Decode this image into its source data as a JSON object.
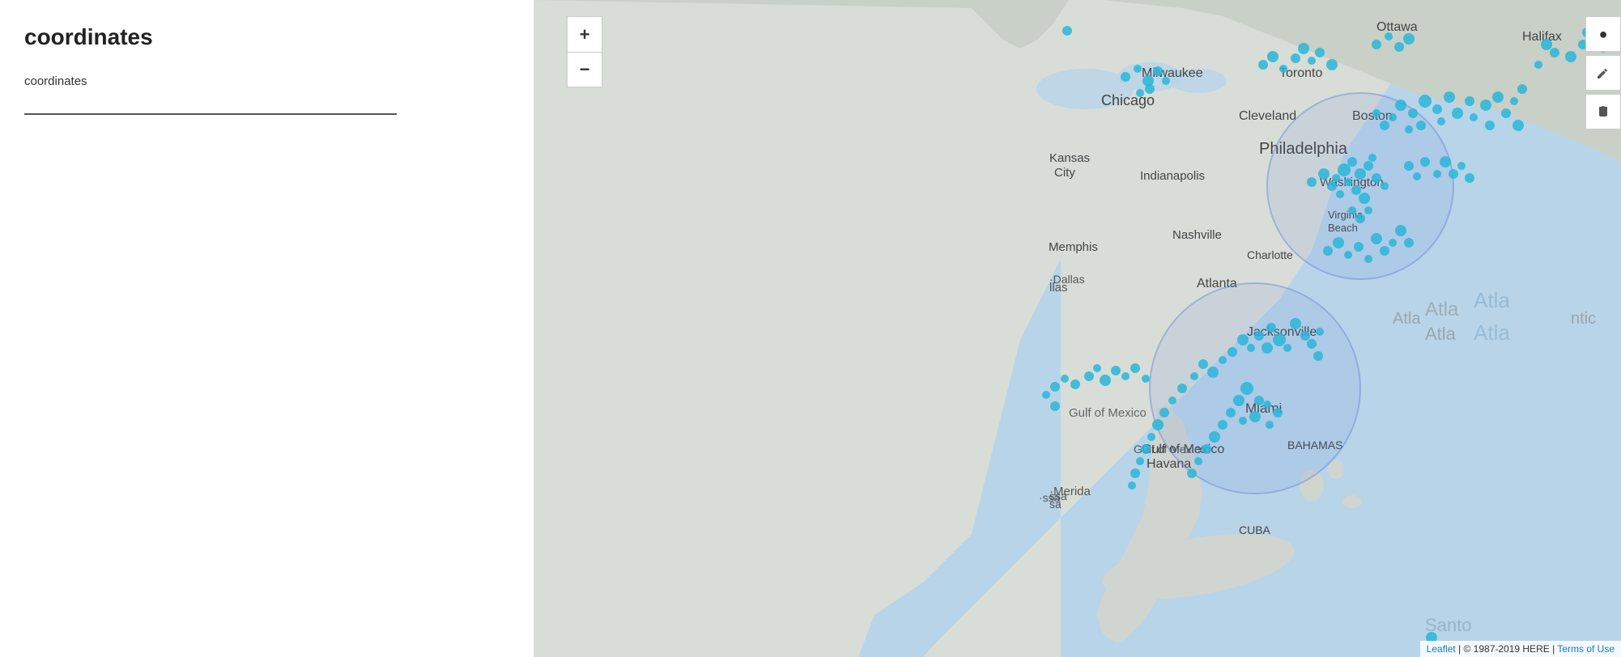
{
  "left_panel": {
    "title": "coordinates",
    "field_label": "coordinates",
    "field_placeholder": ""
  },
  "map": {
    "zoom_in_label": "+",
    "zoom_out_label": "−",
    "attribution_text": "| © 1987-2019 HERE |",
    "leaflet_link_text": "Leaflet",
    "terms_link_text": "Terms of Use",
    "city_labels": [
      "Ottawa",
      "Halifax",
      "Toronto",
      "Boston",
      "Milwaukee",
      "Chicago",
      "Cleveland",
      "Philadelphia",
      "Kansas City",
      "Indianapolis",
      "Washington",
      "Virginia Beach",
      "Nashville",
      "Charlotte",
      "Memphis",
      "Atlanta",
      "Jacksonville",
      "Miami",
      "Havana",
      "BAHAMAS",
      "CUBA",
      "Gulf of Mexico",
      "Merida",
      "Santo",
      "Atlantic",
      "Dallas"
    ],
    "right_btn_icons": [
      "●",
      "✎",
      "🗑"
    ]
  }
}
